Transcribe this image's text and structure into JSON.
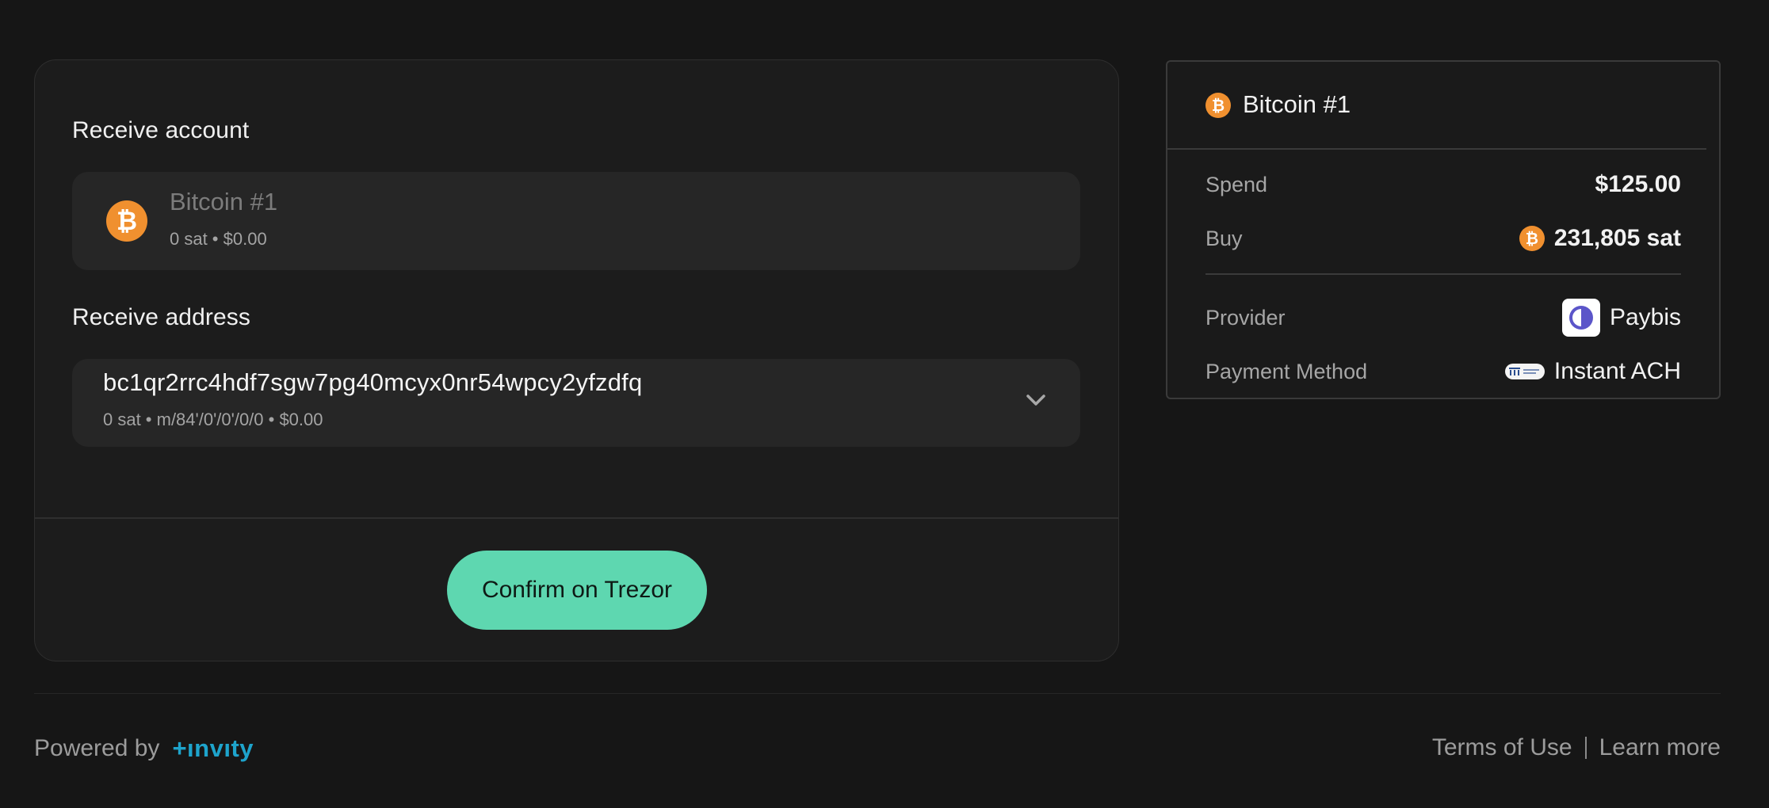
{
  "receive_account": {
    "title": "Receive account",
    "account_name": "Bitcoin #1",
    "account_meta": "0 sat • $0.00",
    "coin_symbol": "₿"
  },
  "receive_address": {
    "title": "Receive address",
    "address": "bc1qr2rrc4hdf7sgw7pg40mcyx0nr54wpcy2yfzdfq",
    "meta": "0 sat • m/84'/0'/0'/0/0 • $0.00"
  },
  "confirm_button": {
    "label": "Confirm on Trezor",
    "color": "#5ed7b0"
  },
  "summary": {
    "title": "Bitcoin #1",
    "coin_symbol": "₿",
    "rows": [
      {
        "label": "Spend",
        "value": "$125.00"
      },
      {
        "label": "Buy",
        "value": "231,805 sat"
      },
      {
        "label": "Provider",
        "value": "Paybis"
      },
      {
        "label": "Payment Method",
        "value": "Instant ACH"
      }
    ]
  },
  "footer": {
    "powered_by": "Powered by",
    "brand": "+ınvıty",
    "brand_color": "#1ea4cc",
    "links": [
      "Terms of Use",
      "Learn more"
    ]
  },
  "colors": {
    "bitcoin": "#f0902f",
    "background": "#161616",
    "card": "#1c1c1c"
  }
}
